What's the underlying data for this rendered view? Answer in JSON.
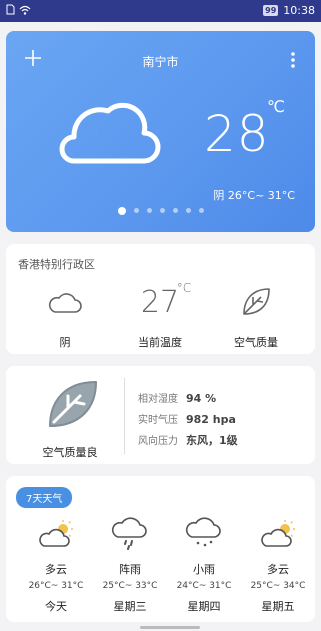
{
  "status_bar": {
    "battery": "99",
    "time": "10:38"
  },
  "hero": {
    "city": "南宁市",
    "temperature": "28",
    "unit": "℃",
    "condition_range": "阴 26°C~ 31°C",
    "page_count": 7,
    "active_page": 0
  },
  "summary": {
    "region": "香港特别行政区",
    "cols": [
      {
        "icon": "cloud-icon",
        "label": "阴"
      },
      {
        "value": "27",
        "unit": "°C",
        "label": "当前温度"
      },
      {
        "icon": "leaf-icon",
        "label": "空气质量"
      }
    ]
  },
  "details": {
    "air_quality_label": "空气质量良",
    "rows": [
      {
        "label": "相对湿度",
        "value": "94 %"
      },
      {
        "label": "实时气压",
        "value": "982 hpa"
      },
      {
        "label": "风向压力",
        "value": "东风，1级"
      }
    ]
  },
  "forecast": {
    "badge": "7天天气",
    "days": [
      {
        "icon": "partly-cloudy-icon",
        "desc": "多云",
        "range": "26°C~ 31°C",
        "day": "今天"
      },
      {
        "icon": "rain-icon",
        "desc": "阵雨",
        "range": "25°C~ 33°C",
        "day": "星期三"
      },
      {
        "icon": "light-rain-icon",
        "desc": "小雨",
        "range": "24°C~ 31°C",
        "day": "星期四"
      },
      {
        "icon": "partly-cloudy-icon",
        "desc": "多云",
        "range": "25°C~ 34°C",
        "day": "星期五"
      }
    ]
  }
}
